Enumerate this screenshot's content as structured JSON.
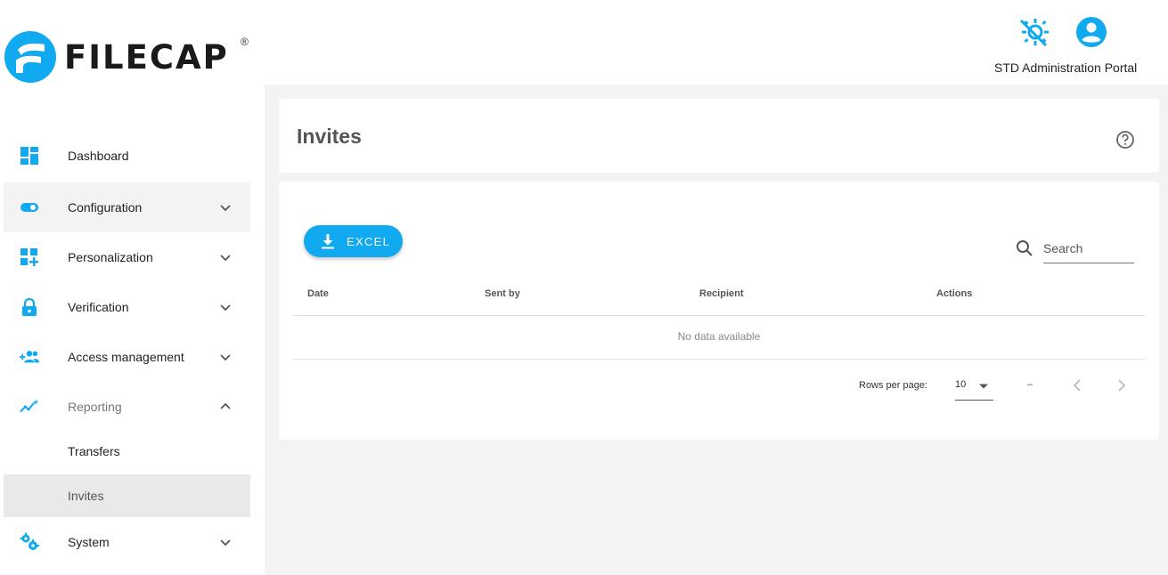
{
  "header": {
    "logo_text": "FILECAP",
    "logo_reg": "®",
    "portal_label": "STD Administration Portal",
    "icons": [
      "theme-toggle-icon",
      "account-circle-icon"
    ],
    "accent_color": "#11aaf0"
  },
  "sidebar": {
    "items": [
      {
        "label": "Dashboard",
        "icon": "dashboard-icon"
      },
      {
        "label": "Configuration",
        "icon": "toggle-icon"
      },
      {
        "label": "Personalization",
        "icon": "widgets-add-icon"
      },
      {
        "label": "Verification",
        "icon": "lock-icon"
      },
      {
        "label": "Access management",
        "icon": "group-add-icon"
      },
      {
        "label": "Reporting",
        "icon": "analytics-icon"
      },
      {
        "label": "System",
        "icon": "settings-gears-icon"
      }
    ],
    "reporting_sub": [
      {
        "label": "Transfers"
      },
      {
        "label": "Invites"
      }
    ]
  },
  "page": {
    "title": "Invites"
  },
  "toolbar": {
    "excel_label": "EXCEL",
    "search_placeholder": "Search"
  },
  "table": {
    "columns": [
      "Date",
      "Sent by",
      "Recipient",
      "Actions"
    ],
    "empty_text": "No data available",
    "rows": []
  },
  "pagination": {
    "rows_per_page_label": "Rows per page:",
    "rows_per_page": "10",
    "range_text": "–"
  }
}
